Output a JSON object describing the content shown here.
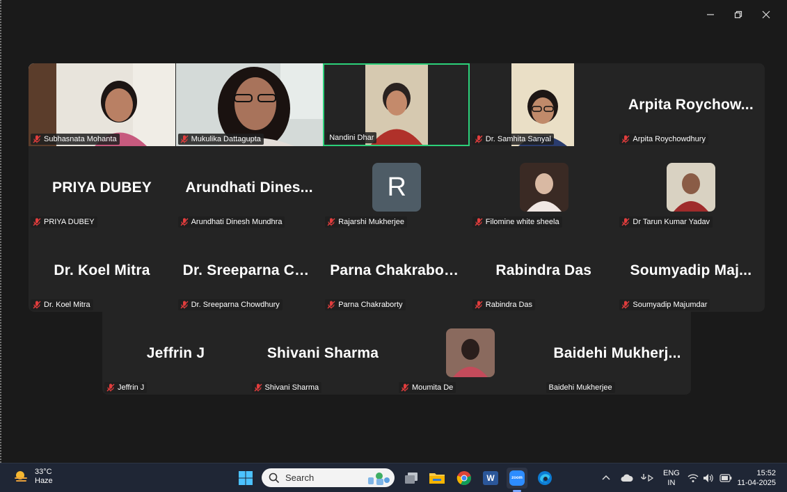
{
  "window": {
    "controls": [
      "minimize",
      "restore",
      "close"
    ]
  },
  "participants_top": [
    {
      "display": "",
      "label": "Subhasnata Mohanta",
      "video": true,
      "muted": true
    },
    {
      "display": "",
      "label": "Mukulika Dattagupta",
      "video": true,
      "muted": true
    },
    {
      "display": "",
      "label": "Nandini Dhar",
      "video": true,
      "muted": false,
      "active": true
    },
    {
      "display": "",
      "label": "Dr. Samhita Sanyal",
      "video": true,
      "muted": true
    },
    {
      "display": "Arpita  Roychow...",
      "label": "Arpita Roychowdhury",
      "muted": true
    },
    {
      "display": "PRIYA DUBEY",
      "label": "PRIYA DUBEY",
      "muted": true
    },
    {
      "display": "Arundhati  Dines...",
      "label": "Arundhati Dinesh Mundhra",
      "muted": true
    },
    {
      "display": "",
      "avatar_letter": "R",
      "label": "Rajarshi Mukherjee",
      "muted": true
    },
    {
      "display": "",
      "avatar_pic": true,
      "label": "Filomine white sheela",
      "muted": true
    },
    {
      "display": "",
      "avatar_pic": true,
      "label": "Dr Tarun Kumar Yadav",
      "muted": true
    },
    {
      "display": "Dr. Koel Mitra",
      "label": "Dr. Koel Mitra",
      "muted": true
    },
    {
      "display": "Dr. Sreeparna  Ch...",
      "label": "Dr. Sreeparna Chowdhury",
      "muted": true
    },
    {
      "display": "Parna Chakraborty",
      "label": "Parna Chakraborty",
      "muted": true
    },
    {
      "display": "Rabindra Das",
      "label": "Rabindra Das",
      "muted": true
    },
    {
      "display": "Soumyadip  Maj...",
      "label": "Soumyadip Majumdar",
      "muted": true
    }
  ],
  "participants_bottom": [
    {
      "display": "Jeffrin J",
      "label": "Jeffrin J",
      "muted": true
    },
    {
      "display": "Shivani Sharma",
      "label": "Shivani Sharma",
      "muted": true
    },
    {
      "display": "",
      "avatar_pic": true,
      "label": "Moumita De",
      "muted": true
    },
    {
      "display": "Baidehi  Mukherj...",
      "label": "Baidehi Mukherjee",
      "muted": false
    }
  ],
  "taskbar": {
    "weather_temp": "33°C",
    "weather_desc": "Haze",
    "search_placeholder": "Search",
    "zoom_label": "zoom",
    "word_label": "W",
    "lang_top": "ENG",
    "lang_bottom": "IN",
    "time": "15:52",
    "date": "11-04-2025"
  },
  "colors": {
    "background": "#1a1a1a",
    "tile": "#242424",
    "active_border": "#2cd17a",
    "taskbar": "#1f2635"
  }
}
